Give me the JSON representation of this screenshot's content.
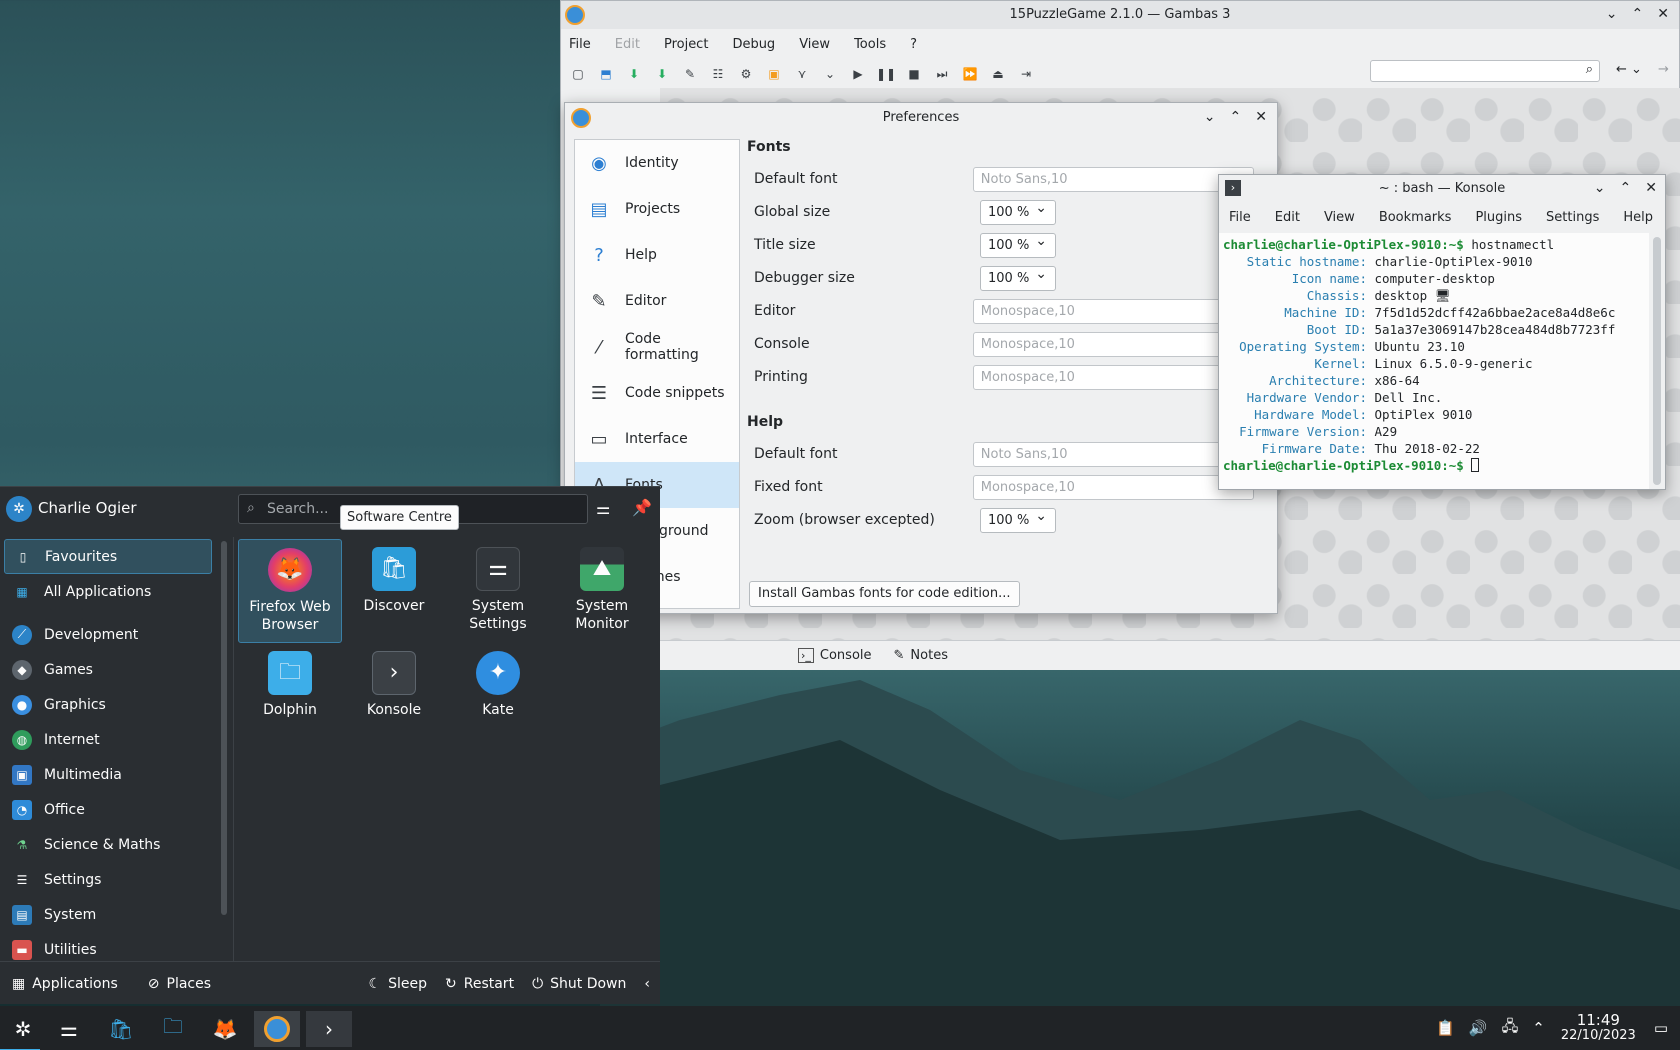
{
  "gambas": {
    "title": "15PuzzleGame 2.1.0 — Gambas 3",
    "menu": [
      "File",
      "Edit",
      "Project",
      "Debug",
      "View",
      "Tools",
      "?"
    ],
    "bottom_tabs": [
      "Console",
      "Notes"
    ]
  },
  "prefs": {
    "title": "Preferences",
    "sidebar": [
      {
        "label": "Identity",
        "icon": "person-icon"
      },
      {
        "label": "Projects",
        "icon": "projects-icon"
      },
      {
        "label": "Help",
        "icon": "help-icon"
      },
      {
        "label": "Editor",
        "icon": "editor-icon"
      },
      {
        "label": "Code formatting",
        "icon": "wand-icon"
      },
      {
        "label": "Code snippets",
        "icon": "snippet-icon"
      },
      {
        "label": "Interface",
        "icon": "interface-icon"
      },
      {
        "label": "Fonts",
        "icon": "fonts-icon"
      },
      {
        "label": "Background",
        "icon": "background-icon"
      },
      {
        "label": "Themes",
        "icon": "themes-icon"
      }
    ],
    "fonts_heading": "Fonts",
    "help_heading": "Help",
    "rows": {
      "default_font": {
        "label": "Default font",
        "value": "Noto Sans,10"
      },
      "global_size": {
        "label": "Global size",
        "value": "100 %"
      },
      "title_size": {
        "label": "Title size",
        "value": "100 %"
      },
      "debugger_size": {
        "label": "Debugger size",
        "value": "100 %"
      },
      "editor": {
        "label": "Editor",
        "value": "Monospace,10"
      },
      "console": {
        "label": "Console",
        "value": "Monospace,10"
      },
      "printing": {
        "label": "Printing",
        "value": "Monospace,10"
      },
      "help_default_font": {
        "label": "Default font",
        "value": "Noto Sans,10"
      },
      "fixed_font": {
        "label": "Fixed font",
        "value": "Monospace,10"
      },
      "zoom": {
        "label": "Zoom (browser excepted)",
        "value": "100 %"
      }
    },
    "install_button": "Install Gambas fonts for code edition..."
  },
  "konsole": {
    "title": "~ : bash — Konsole",
    "menu": [
      "File",
      "Edit",
      "View",
      "Bookmarks",
      "Plugins",
      "Settings",
      "Help"
    ],
    "prompt": "charlie@charlie-OptiPlex-9010:~$",
    "command": " hostnamectl",
    "lines": [
      {
        "k": "Static hostname:",
        "v": "charlie-OptiPlex-9010"
      },
      {
        "k": "Icon name:",
        "v": "computer-desktop"
      },
      {
        "k": "Chassis:",
        "v": "desktop 🖥"
      },
      {
        "k": "Machine ID:",
        "v": "7f5d1d52dcff42a6bbae2ace8a4d8e6c"
      },
      {
        "k": "Boot ID:",
        "v": "5a1a37e3069147b28cea484d8b7723ff"
      },
      {
        "k": "Operating System:",
        "v": "Ubuntu 23.10"
      },
      {
        "k": "Kernel:",
        "v": "Linux 6.5.0-9-generic"
      },
      {
        "k": "Architecture:",
        "v": "x86-64"
      },
      {
        "k": "Hardware Vendor:",
        "v": "Dell Inc."
      },
      {
        "k": "Hardware Model:",
        "v": "OptiPlex 9010"
      },
      {
        "k": "Firmware Version:",
        "v": "A29"
      },
      {
        "k": "Firmware Date:",
        "v": "Thu 2018-02-22"
      }
    ]
  },
  "launcher": {
    "user": "Charlie Ogier",
    "search_placeholder": "Search...",
    "tooltip": "Software Centre",
    "categories": [
      "Favourites",
      "All Applications",
      "Development",
      "Games",
      "Graphics",
      "Internet",
      "Multimedia",
      "Office",
      "Science & Maths",
      "Settings",
      "System",
      "Utilities"
    ],
    "apps": [
      {
        "label": "Firefox Web Browser",
        "icon": "firefox-icon"
      },
      {
        "label": "Discover",
        "icon": "discover-icon"
      },
      {
        "label": "System Settings",
        "icon": "system-settings-icon"
      },
      {
        "label": "System Monitor",
        "icon": "system-monitor-icon"
      },
      {
        "label": "Dolphin",
        "icon": "dolphin-icon"
      },
      {
        "label": "Konsole",
        "icon": "konsole-icon"
      },
      {
        "label": "Kate",
        "icon": "kate-icon"
      }
    ],
    "footer": {
      "applications": "Applications",
      "places": "Places",
      "sleep": "Sleep",
      "restart": "Restart",
      "shutdown": "Shut Down"
    }
  },
  "taskbar": {
    "time": "11:49",
    "date": "22/10/2023"
  }
}
